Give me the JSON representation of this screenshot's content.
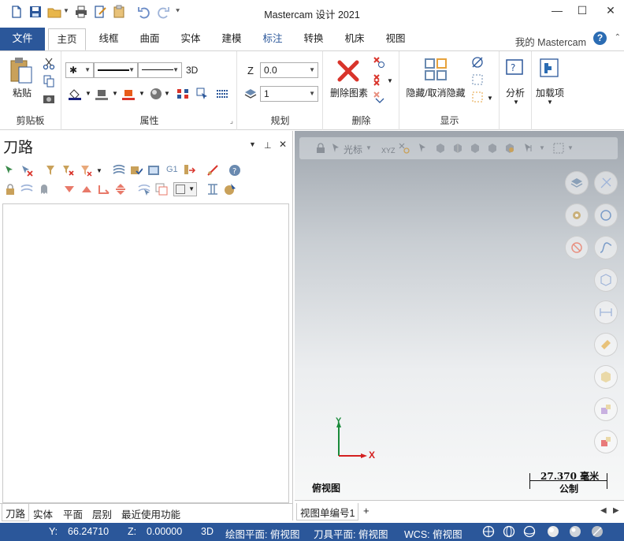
{
  "window": {
    "title": "Mastercam 设计 2021",
    "minimize": "—",
    "maximize": "☐",
    "close": "✕"
  },
  "ribbon_tabs": {
    "file": "文件",
    "items": [
      "主页",
      "线框",
      "曲面",
      "实体",
      "建模",
      "标注",
      "转换",
      "机床",
      "视图"
    ],
    "active": "主页",
    "my_mastercam": "我的 Mastercam",
    "help": "?"
  },
  "ribbon": {
    "clipboard": {
      "paste": "粘贴",
      "group": "剪贴板"
    },
    "attributes": {
      "point_style": "✱",
      "threed": "3D",
      "group": "属性"
    },
    "planning": {
      "z_label": "Z",
      "z_value": "0.0",
      "level_value": "1",
      "group": "规划"
    },
    "delete": {
      "delete_entities": "删除图素",
      "group": "删除"
    },
    "display": {
      "hide_unhide": "隐藏/取消隐藏",
      "group": "显示"
    },
    "analyze": {
      "label": "分析"
    },
    "addins": {
      "label": "加载项"
    }
  },
  "toolpaths_panel": {
    "title": "刀路",
    "pin": "ᵖ",
    "close": "✕",
    "bottom_tabs": [
      "刀路",
      "实体",
      "平面",
      "层别",
      "最近使用功能"
    ],
    "active_tab": "刀路",
    "g1_label": "G1"
  },
  "graphics": {
    "toolbar_cursor_label": "光标",
    "toolbar_xyz_label": "XYZ",
    "axis_x": "X",
    "axis_y": "Y",
    "view_name": "俯视图",
    "scale_value": "27.370 毫米",
    "scale_unit": "公制"
  },
  "viewsheets": {
    "tab": "视图单编号1",
    "add": "+"
  },
  "status_bar": {
    "y_label": "Y:",
    "y_value": "66.24710",
    "z_label": "Z:",
    "z_value": "0.00000",
    "mode": "3D",
    "cplane": "绘图平面: 俯视图",
    "tplane": "刀具平面: 俯视图",
    "wcs": "WCS: 俯视图"
  },
  "colors": {
    "brand_blue": "#2b579a",
    "delete_red": "#d9342b",
    "axis_green": "#1a8a3a",
    "axis_red": "#d42020"
  }
}
